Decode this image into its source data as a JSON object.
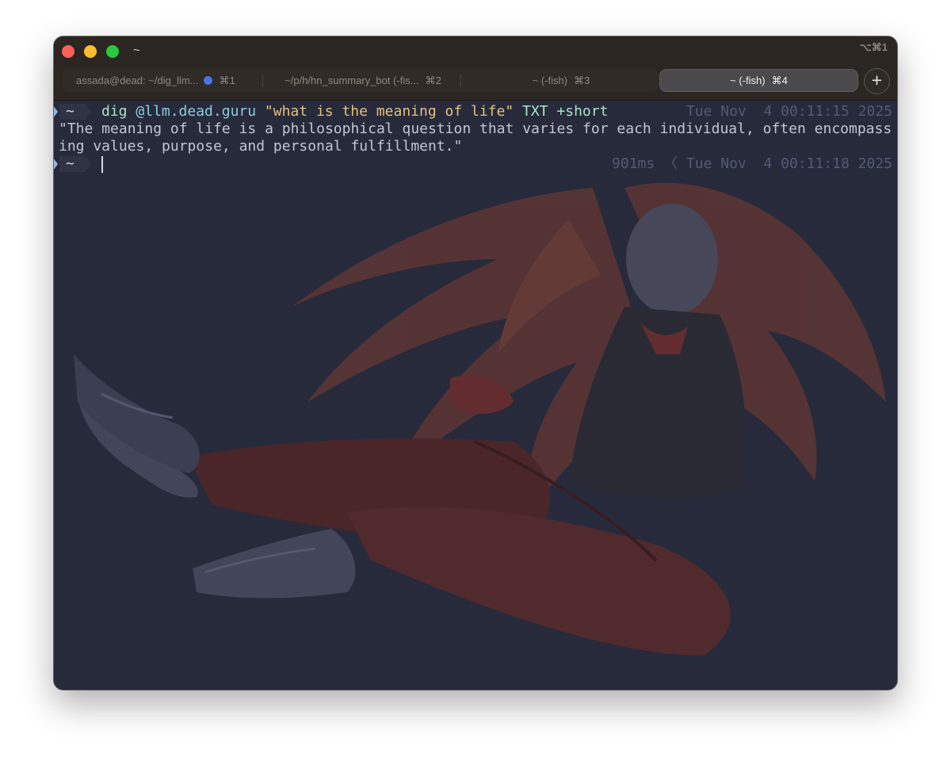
{
  "window": {
    "title": "~",
    "shortcut": "⌥⌘1"
  },
  "tabs": [
    {
      "label": "assada@dead: ~/dig_llm...",
      "shortcut": "⌘1",
      "has_activity_dot": true
    },
    {
      "label": "~/p/h/hn_summary_bot (-fis...",
      "shortcut": "⌘2"
    },
    {
      "label": "~ (-fish)",
      "shortcut": "⌘3"
    },
    {
      "label": "~ (-fish)",
      "shortcut": "⌘4",
      "active": true
    }
  ],
  "new_tab_label": "+",
  "terminal": {
    "prompt_cwd": "~",
    "command": {
      "program": "dig",
      "server": "@llm.dead.guru",
      "query": "\"what is the meaning of life\"",
      "type": "TXT",
      "flag": "+short"
    },
    "command_time": "Tue Nov  4 00:11:15 2025",
    "output_line1": "\"The meaning of life is a philosophical question that varies for each individual, often encompass",
    "output_line2": "ing values, purpose, and personal fulfillment.\"",
    "prompt2_cwd": "~",
    "prompt2_right": "901ms 〈 Tue Nov  4 00:11:18 2025"
  },
  "colors": {
    "terminal_bg": "#272a3b",
    "titlebar_bg": "#2b2621",
    "prompt_arrow": "#8fb8ea",
    "command": "#a9e3c6",
    "string": "#e6c07b",
    "output_text": "#c2c6d3",
    "right_prompt": "#535a73",
    "activity_dot": "#4a73e8"
  },
  "icons": [
    "close-window-button",
    "minimize-window-button",
    "maximize-window-button",
    "plus-icon",
    "prompt-arrow-icon"
  ]
}
